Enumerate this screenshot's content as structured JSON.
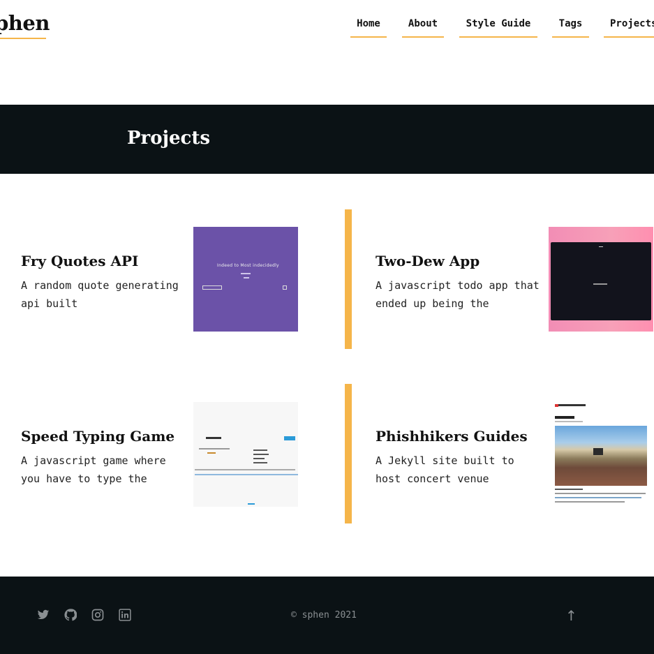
{
  "site": {
    "logo": "phen"
  },
  "nav": {
    "items": [
      {
        "label": "Home"
      },
      {
        "label": "About"
      },
      {
        "label": "Style Guide"
      },
      {
        "label": "Tags"
      },
      {
        "label": "Projects"
      }
    ]
  },
  "hero": {
    "title": "Projects"
  },
  "projects": [
    {
      "title": "Fry Quotes API",
      "description": "A random quote generating api built",
      "thumbnail_text": "Indeed to  Most indecidedly"
    },
    {
      "title": "Two-Dew App",
      "description": "A javascript todo app that ended up being the"
    },
    {
      "title": "Speed Typing Game",
      "description": "A javascript game where you have to type the"
    },
    {
      "title": "Phishhikers Guides",
      "description": "A Jekyll site built to host concert venue"
    }
  ],
  "footer": {
    "social_icons": [
      "twitter-icon",
      "github-icon",
      "instagram-icon",
      "linkedin-icon"
    ],
    "copyright": "© sphen 2021",
    "back_to_top": "↑"
  },
  "colors": {
    "accent": "#f5b54a",
    "dark": "#0b1215",
    "footer_text": "#8a8f92"
  }
}
